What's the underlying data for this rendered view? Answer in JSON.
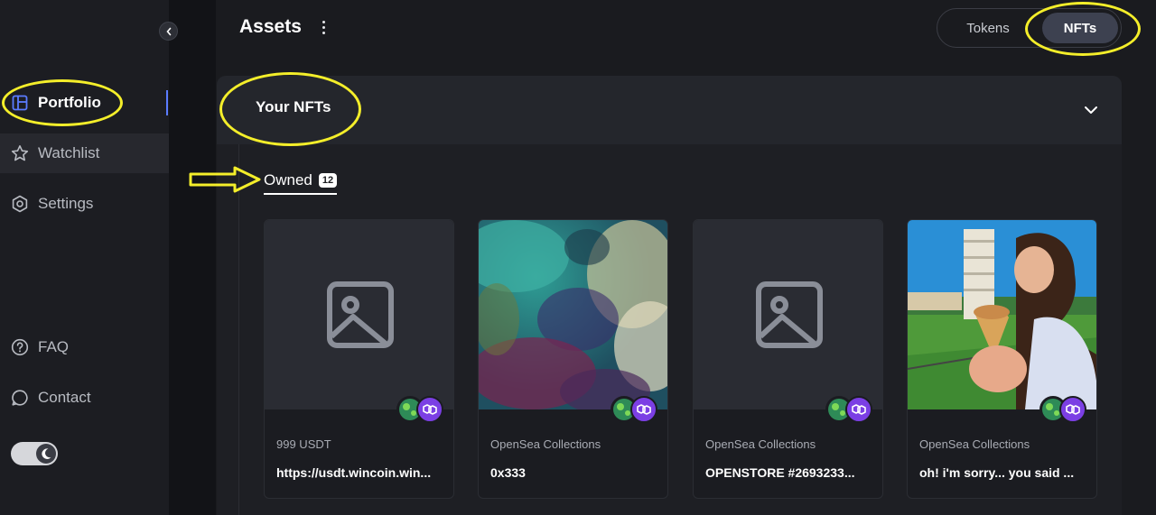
{
  "sidebar": {
    "items": [
      {
        "label": "Portfolio",
        "icon": "portfolio-icon",
        "active": true
      },
      {
        "label": "Watchlist",
        "icon": "star-icon"
      },
      {
        "label": "Settings",
        "icon": "gear-icon"
      }
    ],
    "footer": [
      {
        "label": "FAQ",
        "icon": "help-icon"
      },
      {
        "label": "Contact",
        "icon": "chat-icon"
      }
    ],
    "theme_toggle": "dark"
  },
  "header": {
    "title": "Assets",
    "segment": {
      "tokens": "Tokens",
      "nfts": "NFTs",
      "selected": "NFTs"
    }
  },
  "panel": {
    "title": "Your NFTs",
    "tab": {
      "label": "Owned",
      "count": "12"
    }
  },
  "cards": [
    {
      "collection": "999 USDT",
      "name": "https://usdt.wincoin.win...",
      "image": "placeholder-image-icon"
    },
    {
      "collection": "OpenSea Collections",
      "name": "0x333",
      "image": "abstract-artwork"
    },
    {
      "collection": "OpenSea Collections",
      "name": "OPENSTORE #2693233...",
      "image": "placeholder-image-icon"
    },
    {
      "collection": "OpenSea Collections",
      "name": "oh! i'm sorry... you said ...",
      "image": "photo-tower-girl"
    }
  ],
  "colors": {
    "highlight": "#f4ee2a",
    "accent": "#5b7cff",
    "polygon": "#7b3fe4"
  }
}
